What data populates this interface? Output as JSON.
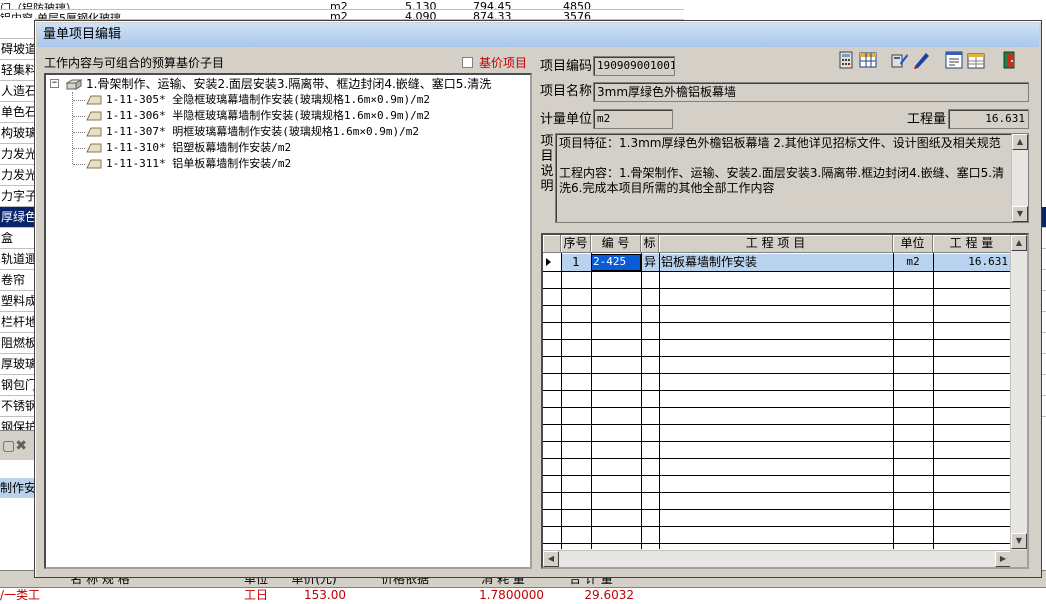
{
  "background": {
    "top_rows": [
      "门（铝防玻璃）",
      "铝内窗-单层5厚钢化玻璃"
    ],
    "top_values": [
      "m2",
      "5.130",
      "794.45",
      "4850",
      "m2",
      "4.090",
      "874.33",
      "3576"
    ],
    "left_items": [
      "",
      "碍坡道",
      "轻集料",
      "人造石",
      "单色石",
      "构玻璃",
      "力发光",
      "力发光",
      "力字子",
      "厚绿色",
      "盒",
      "轨道逦",
      "卷帘",
      "塑料成",
      "栏杆地",
      "阻燃板",
      "厚玻璃",
      "钢包门",
      "不锈钢",
      "钢保护",
      "卡四米"
    ],
    "selected_left_index": 9,
    "mid_row_text": "制作安",
    "bottom_headers": [
      "名  称  规  格",
      "单位",
      "单价(元)",
      "价格依据",
      "消 耗 量",
      "合 计 量"
    ],
    "bottom_row": [
      "/一类工",
      "工日",
      "153.00",
      "",
      "1.7800000",
      "29.6032"
    ]
  },
  "dialog": {
    "title": "量单项目编辑",
    "left_panel": {
      "title": "工作内容与可组合的预算基价子目",
      "base_price_checkbox_label": "基价项目",
      "tree": {
        "root": {
          "expanded": true,
          "label": "1.骨架制作、运输、安装2.面层安装3.隔离带、框边封闭4.嵌缝、塞口5.清洗"
        },
        "children": [
          "1-11-305* 全隐框玻璃幕墙制作安装(玻璃规格1.6m×0.9m)/m2",
          "1-11-306* 半隐框玻璃幕墙制作安装(玻璃规格1.6m×0.9m)/m2",
          "1-11-307* 明框玻璃幕墙制作安装(玻璃规格1.6m×0.9m)/m2",
          "1-11-310* 铝塑板幕墙制作安装/m2",
          "1-11-311* 铝单板幕墙制作安装/m2"
        ]
      }
    },
    "right_panel": {
      "code_label": "项目编码",
      "code_value": "190909001001",
      "name_label": "项目名称",
      "name_value": "3mm厚绿色外檐铝板幕墙",
      "unit_label": "计量单位",
      "unit_value": "m2",
      "quantity_label": "工程量",
      "quantity_value": "16.631",
      "desc_label": "项目说明",
      "description": "项目特征：1.3mm厚绿色外檐铝板幕墙 2.其他详见招标文件、设计图纸及相关规范\n\n工程内容：1.骨架制作、运输、安装2.面层安装3.隔离带.框边封闭4.嵌缝、塞口5.清洗6.完成本项目所需的其他全部工作内容",
      "toolbar_icons": [
        "calculator-icon",
        "table-icon",
        "calc-edit-icon",
        "edit-pen-icon",
        "report-icon",
        "form-grid-icon",
        "exit-door-icon"
      ],
      "grid": {
        "headers": [
          "序号",
          "编 号",
          "标",
          "工    程    项    目",
          "单位",
          "工 程 量"
        ],
        "rows": [
          {
            "seq": "1",
            "code": "2-425",
            "mark": "异",
            "item": "铝板幕墙制作安装",
            "unit": "m2",
            "quantity": "16.631"
          }
        ]
      }
    }
  },
  "colors": {
    "dialog_bg": "#d4d0c8",
    "title_gradient_top": "#cfe2f7",
    "title_gradient_bottom": "#a9c7ea",
    "selection_blue": "#0a246a",
    "row_highlight": "#b9d3ee",
    "cell_focus": "#0a5bd6",
    "accent_red": "#c00000"
  }
}
